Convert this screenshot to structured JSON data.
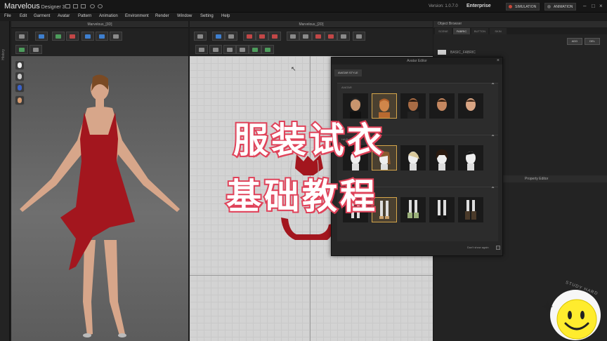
{
  "app": {
    "name_main": "Marvelous",
    "name_sub": " Designer 3",
    "version": "Version: 1.0.7.0",
    "edition": "Enterprise"
  },
  "top_buttons": {
    "simulation": "SIMULATION",
    "animation": "ANIMATION"
  },
  "menu": [
    "File",
    "Edit",
    "Garment",
    "Avatar",
    "Pattern",
    "Animation",
    "Environment",
    "Render",
    "Window",
    "Setting",
    "Help"
  ],
  "left_strip": {
    "label": "History"
  },
  "window_3d": {
    "title": "Marvelous_[3D]"
  },
  "window_2d": {
    "title": "Marvelous_[2D]"
  },
  "object_browser": {
    "title": "Object Browser",
    "tabs": [
      "SCENE",
      "FABRIC",
      "BUTTON",
      "SKIN"
    ],
    "active_tab": "FABRIC",
    "items": [
      {
        "name": "BASIC_FABRIC"
      }
    ],
    "button_add": "ADD",
    "button_delete": "DEL"
  },
  "property_editor": {
    "title": "Property Editor"
  },
  "avatar_editor": {
    "title": "Avatar Editor",
    "tab": "AVATAR STYLE",
    "sections": [
      {
        "label": "AVATAR"
      },
      {
        "label": "HAIR"
      },
      {
        "label": "SHOES"
      }
    ],
    "dont_show": "Don't show again"
  },
  "overlay": {
    "line1": "服装试衣",
    "line2": "基础教程"
  },
  "watermark": {
    "text": "STUDY HARD"
  },
  "colors": {
    "overlay_stroke": "#e0435a",
    "dress": "#a3161e",
    "selected_border": "#d6a64a"
  }
}
